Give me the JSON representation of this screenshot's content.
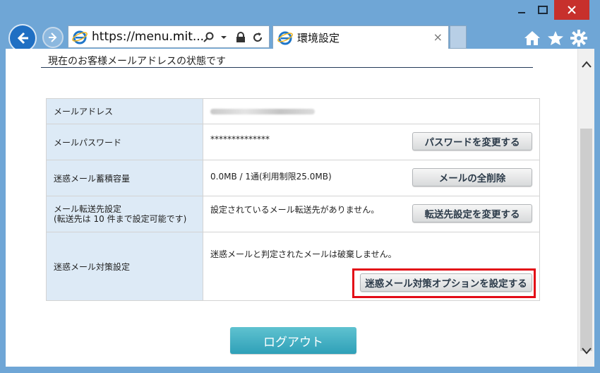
{
  "browser": {
    "url": "https://menu.mit...",
    "url_prefix": "https://menu.",
    "url_domain": "mit...",
    "tab_title": "環境設定",
    "tab_close": "×",
    "window_controls": {
      "minimize": "—",
      "maximize": "☐",
      "close": "✕"
    }
  },
  "page": {
    "heading": "現在のお客様メールアドレスの状態です",
    "rows": [
      {
        "label": "メールアドレス",
        "value": "",
        "button": ""
      },
      {
        "label": "メールパスワード",
        "value": "**************",
        "button": "パスワードを変更する"
      },
      {
        "label": "迷惑メール蓄積容量",
        "value": "0.0MB / 1通(利用制限25.0MB)",
        "button": "メールの全削除"
      },
      {
        "label": "メール転送先設定",
        "label_sub": "(転送先は 10 件まで設定可能です)",
        "value": "設定されているメール転送先がありません。",
        "button": "転送先設定を変更する"
      },
      {
        "label": "迷惑メール対策設定",
        "value": "迷惑メールと判定されたメールは破棄しません。",
        "button": "迷惑メール対策オプションを設定する"
      }
    ],
    "logout": "ログアウト"
  },
  "colors": {
    "highlight": "#e30b17",
    "logout": "#3aa8be",
    "label_bg": "#ddeaf6"
  }
}
